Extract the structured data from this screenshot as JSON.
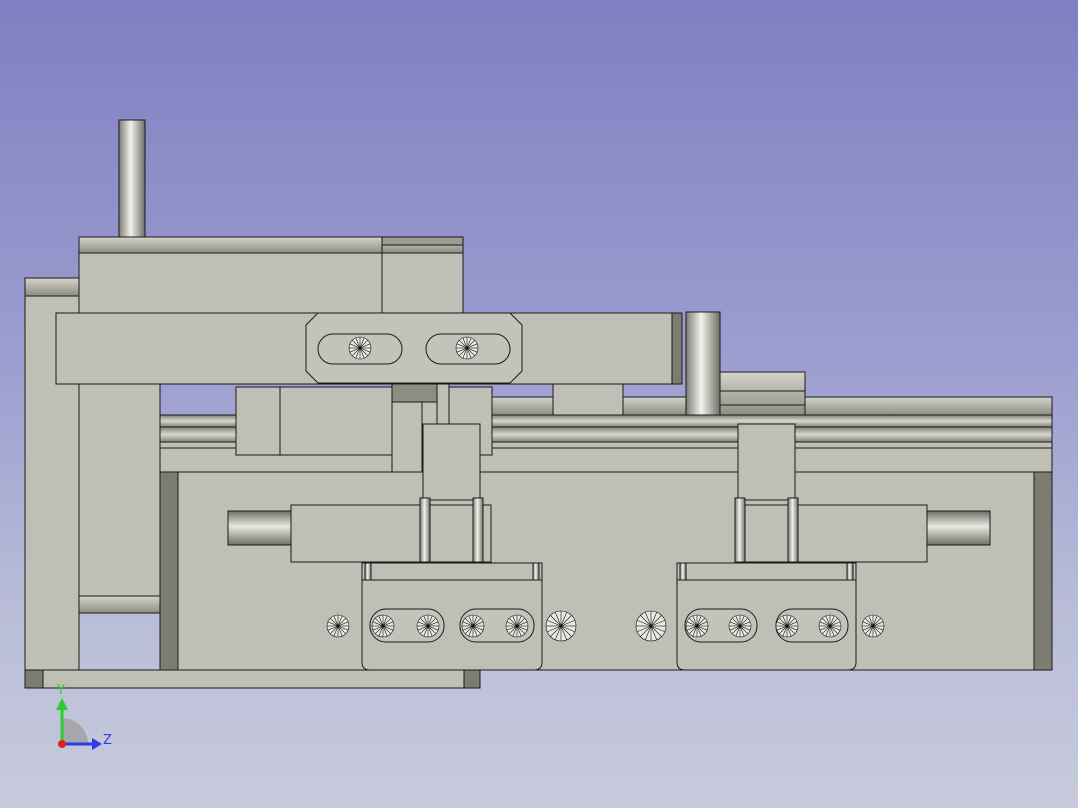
{
  "view": {
    "background_top": "#7f7fc2",
    "background_bottom": "#c7cbdc",
    "part_fill": "#c0bfb6",
    "part_shadow": "#7c7d70",
    "edge_color": "#1a1a1a"
  },
  "axes": {
    "y_label": "Y",
    "z_label": "Z",
    "y_color": "#2ecc2e",
    "z_color": "#2d3ee0",
    "x_color": "#e02020"
  }
}
